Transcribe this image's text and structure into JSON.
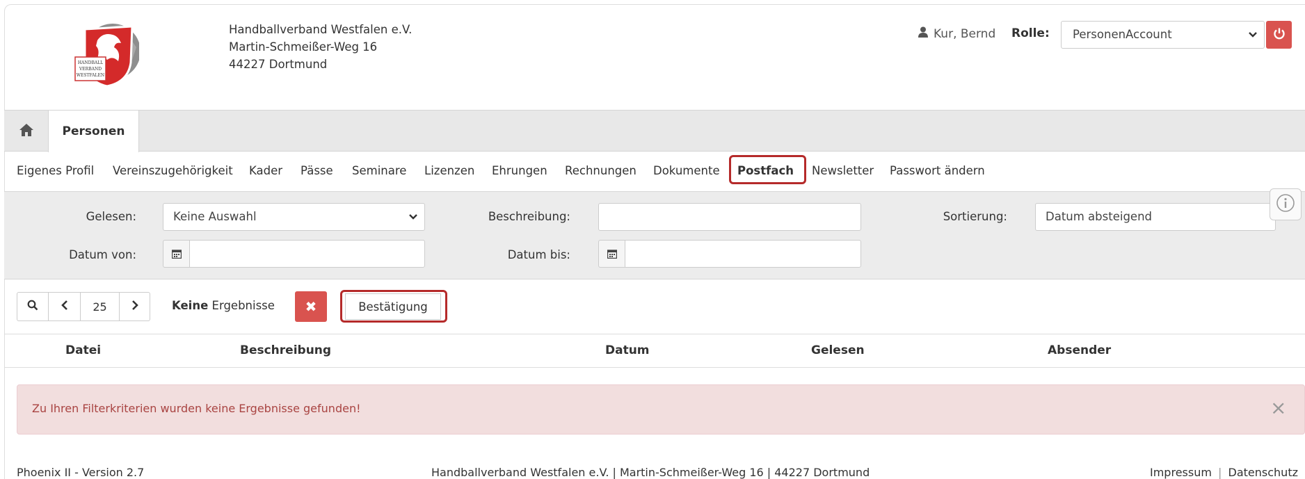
{
  "organization": {
    "name": "Handballverband Westfalen e.V.",
    "street": "Martin-Schmeißer-Weg 16",
    "city": "44227 Dortmund",
    "logo_lines": [
      "HANDBALL",
      "VERBAND",
      "WESTFALEN"
    ]
  },
  "user": {
    "name": "Kur, Bernd",
    "role_label": "Rolle:",
    "role_value": "PersonenAccount"
  },
  "tabs": [
    {
      "label": "Personen",
      "active": true
    }
  ],
  "submenu": [
    {
      "label": "Eigenes Profil"
    },
    {
      "label": "Vereinszugehörigkeit"
    },
    {
      "label": "Kader"
    },
    {
      "label": "Pässe"
    },
    {
      "label": "Seminare"
    },
    {
      "label": "Lizenzen"
    },
    {
      "label": "Ehrungen"
    },
    {
      "label": "Rechnungen"
    },
    {
      "label": "Dokumente"
    },
    {
      "label": "Postfach",
      "active": true
    },
    {
      "label": "Newsletter"
    },
    {
      "label": "Passwort ändern"
    }
  ],
  "filters": {
    "gelesen_label": "Gelesen:",
    "gelesen_value": "Keine Auswahl",
    "beschreibung_label": "Beschreibung:",
    "beschreibung_value": "",
    "sortierung_label": "Sortierung:",
    "sortierung_value": "Datum absteigend",
    "datum_von_label": "Datum von:",
    "datum_von_value": "",
    "datum_bis_label": "Datum bis:",
    "datum_bis_value": ""
  },
  "toolbar": {
    "page_size": "25",
    "results_bold": "Keine",
    "results_rest": " Ergebnisse",
    "confirm_label": "Bestätigung"
  },
  "table": {
    "columns": [
      "Datei",
      "Beschreibung",
      "Datum",
      "Gelesen",
      "Absender"
    ]
  },
  "alert": {
    "message": "Zu Ihren Filterkriterien wurden keine Ergebnisse gefunden!",
    "close": "×"
  },
  "footer": {
    "version": "Phoenix II - Version 2.7",
    "address": "Handballverband Westfalen e.V. | Martin-Schmeißer-Weg 16 | 44227 Dortmund",
    "impressum": "Impressum",
    "separator": "|",
    "datenschutz": "Datenschutz"
  },
  "colors": {
    "danger": "#d9534f",
    "highlight": "#b52a2a",
    "alert_bg": "#f2dede",
    "alert_text": "#a94442"
  }
}
